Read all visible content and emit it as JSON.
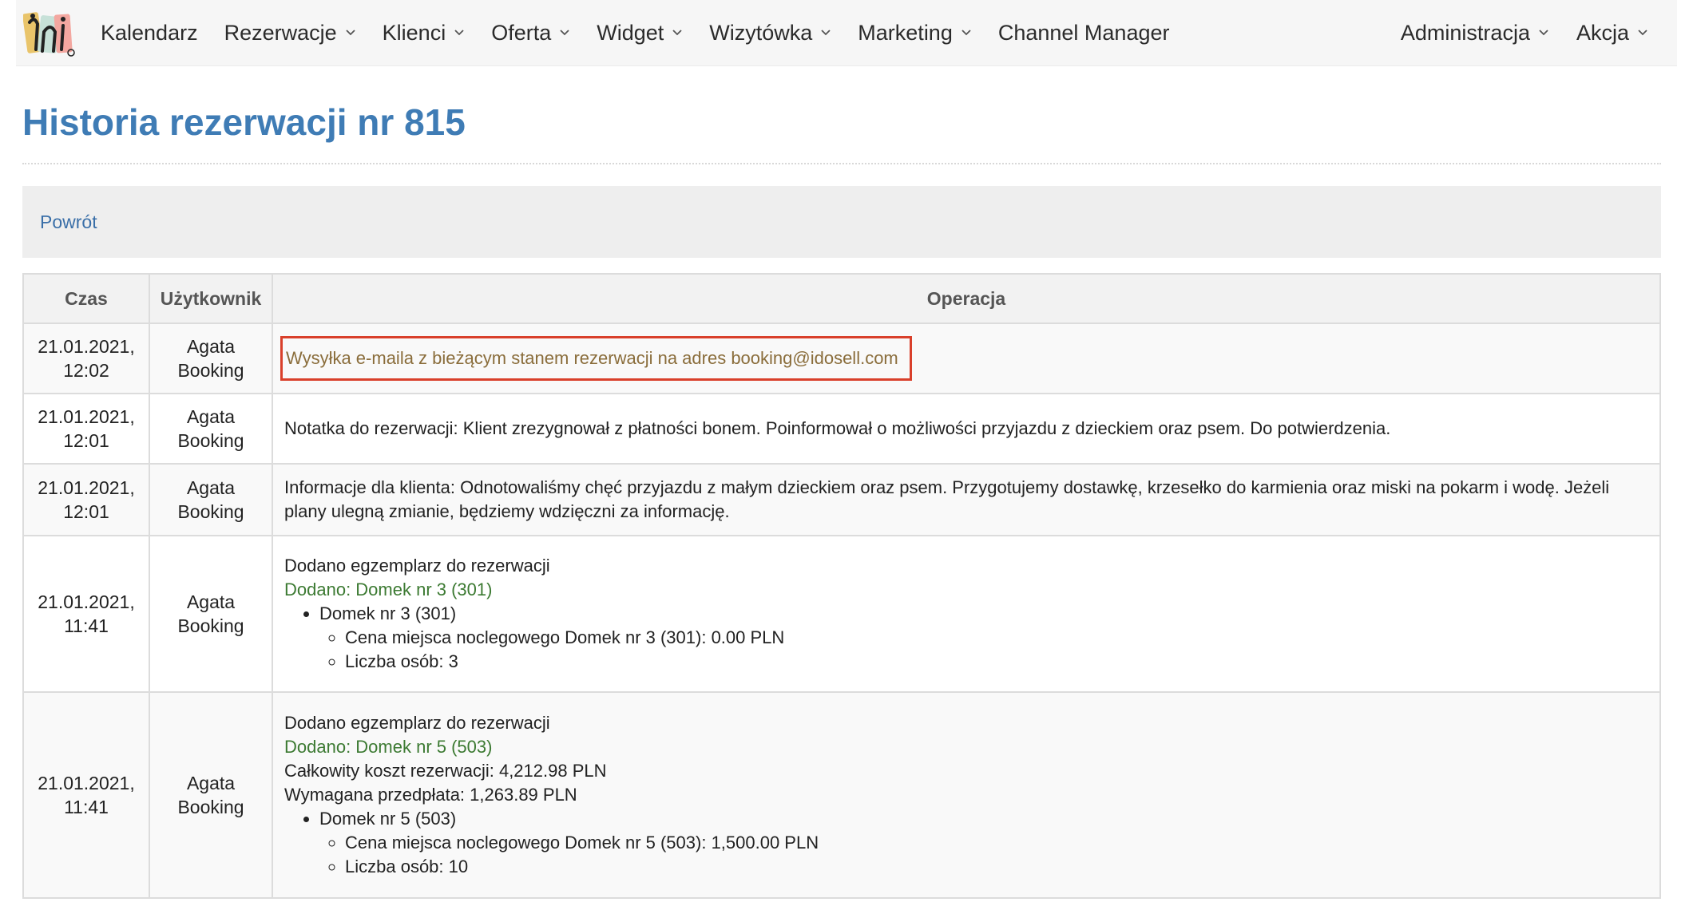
{
  "nav": {
    "items": [
      {
        "label": "Kalendarz",
        "dropdown": false
      },
      {
        "label": "Rezerwacje",
        "dropdown": true
      },
      {
        "label": "Klienci",
        "dropdown": true
      },
      {
        "label": "Oferta",
        "dropdown": true
      },
      {
        "label": "Widget",
        "dropdown": true
      },
      {
        "label": "Wizytówka",
        "dropdown": true
      },
      {
        "label": "Marketing",
        "dropdown": true
      },
      {
        "label": "Channel Manager",
        "dropdown": false
      }
    ],
    "right": [
      {
        "label": "Administracja",
        "dropdown": true
      },
      {
        "label": "Akcja",
        "dropdown": true
      }
    ]
  },
  "page": {
    "title": "Historia rezerwacji nr 815",
    "back_label": "Powrót"
  },
  "table": {
    "headers": [
      "Czas",
      "Użytkownik",
      "Operacja"
    ],
    "rows": [
      {
        "time_date": "21.01.2021,",
        "time_hour": "12:02",
        "user_first": "Agata",
        "user_last": "Booking",
        "text": "Wysyłka e-maila z bieżącym stanem rezerwacji na adres booking@idosell.com"
      },
      {
        "time_date": "21.01.2021,",
        "time_hour": "12:01",
        "user_first": "Agata",
        "user_last": "Booking",
        "text": "Notatka do rezerwacji: Klient zrezygnował z płatności bonem. Poinformował o możliwości przyjazdu z dzieckiem oraz psem. Do potwierdzenia."
      },
      {
        "time_date": "21.01.2021,",
        "time_hour": "12:01",
        "user_first": "Agata",
        "user_last": "Booking",
        "text": "Informacje dla klienta: Odnotowaliśmy chęć przyjazdu z małym dzieckiem oraz psem. Przygotujemy dostawkę, krzesełko do karmienia oraz miski na pokarm i wodę. Jeżeli plany ulegną zmianie, będziemy wdzięczni za informację."
      },
      {
        "time_date": "21.01.2021,",
        "time_hour": "11:41",
        "user_first": "Agata",
        "user_last": "Booking",
        "line1": "Dodano egzemplarz do rezerwacji",
        "added": "Dodano: Domek nr 3 (301)",
        "item": "Domek nr 3 (301)",
        "sub1": "Cena miejsca noclegowego Domek nr 3 (301): 0.00 PLN",
        "sub2": "Liczba osób: 3"
      },
      {
        "time_date": "21.01.2021,",
        "time_hour": "11:41",
        "user_first": "Agata",
        "user_last": "Booking",
        "line1": "Dodano egzemplarz do rezerwacji",
        "added": "Dodano: Domek nr 5 (503)",
        "total": "Całkowity koszt rezerwacji: 4,212.98 PLN",
        "prepay": "Wymagana przedpłata: 1,263.89 PLN",
        "item": "Domek nr 5 (503)",
        "sub1": "Cena miejsca noclegowego Domek nr 5 (503): 1,500.00 PLN",
        "sub2": "Liczba osób: 10"
      }
    ]
  },
  "colors": {
    "title": "#3f7cb5",
    "link": "#3a6fa8",
    "highlight_border": "#d9402b",
    "email_text": "#8a6d3b",
    "added_green": "#3c7a32"
  }
}
